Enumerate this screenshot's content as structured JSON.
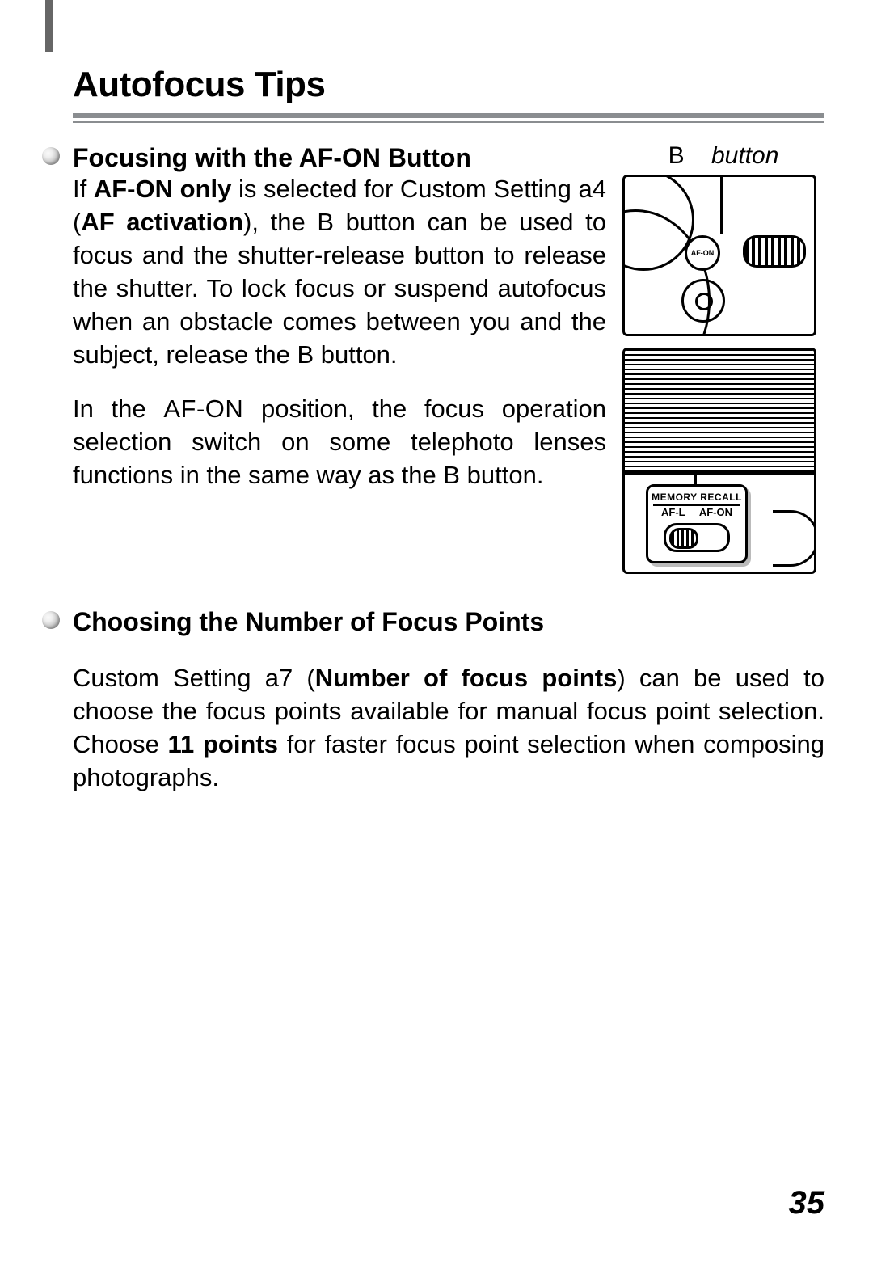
{
  "page": {
    "title": "Autofocus Tips",
    "number": "35"
  },
  "section1": {
    "heading": "Focusing with the AF-ON Button",
    "p1_a": "If ",
    "p1_b_bold": "AF-ON only",
    "p1_c": " is selected for Custom Setting a4 (",
    "p1_d_bold": "AF activation",
    "p1_e": "), the B button can be used to focus and the shutter-release button to release the shutter. To lock focus or suspend autofocus when an obstacle comes between you and the subject, release the B button.",
    "p2_a": "In the ",
    "p2_b_sc": "AF-ON",
    "p2_c": " position, the focus operation selection switch on some telephoto lenses functions in the same way as the B button.",
    "fig_label_a": "B",
    "fig_label_b": "button",
    "afon": "AF-ON",
    "switch_top": "MEMORY RECALL",
    "switch_left": "AF-L",
    "switch_right": "AF-ON"
  },
  "section2": {
    "heading": "Choosing the Number of Focus Points",
    "p_a": "Custom Setting a7 (",
    "p_b_bold": "Number of focus points",
    "p_c": ") can be used to choose the focus points available for manual focus point selection. Choose ",
    "p_d_bold": "11 points",
    "p_e": " for faster focus point selection when composing photographs."
  }
}
